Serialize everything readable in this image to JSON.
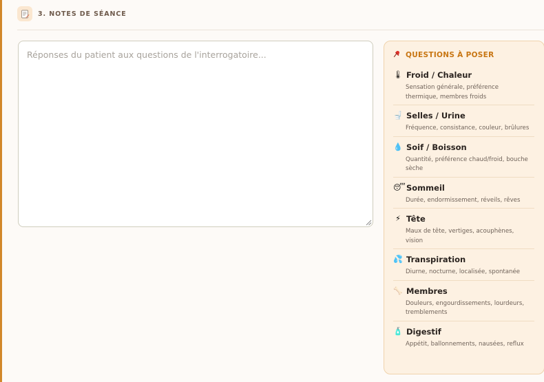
{
  "section": {
    "title": "3. NOTES DE SÉANCE",
    "icon": "memo-icon"
  },
  "notes": {
    "placeholder": "Réponses du patient aux questions de l'interrogatoire...",
    "value": ""
  },
  "questions": {
    "title": "QUESTIONS À POSER",
    "icon": "pushpin-icon",
    "items": [
      {
        "icon": "thermometer-icon",
        "glyph": "🌡",
        "label": "Froid / Chaleur",
        "desc": "Sensation générale, préférence thermique, membres froids"
      },
      {
        "icon": "toilet-icon",
        "glyph": "🚽",
        "label": "Selles / Urine",
        "desc": "Fréquence, consistance, couleur, brûlures"
      },
      {
        "icon": "droplet-icon",
        "glyph": "💧",
        "label": "Soif / Boisson",
        "desc": "Quantité, préférence chaud/froid, bouche sèche"
      },
      {
        "icon": "sleeping-face-icon",
        "glyph": "😴",
        "label": "Sommeil",
        "desc": "Durée, endormissement, réveils, rêves"
      },
      {
        "icon": "head-icon",
        "glyph": "⚡",
        "label": "Tête",
        "desc": "Maux de tête, vertiges, acouphènes, vision"
      },
      {
        "icon": "sweat-droplets-icon",
        "glyph": "💦",
        "label": "Transpiration",
        "desc": "Diurne, nocturne, localisée, spontanée"
      },
      {
        "icon": "bone-icon",
        "glyph": "🦴",
        "label": "Membres",
        "desc": "Douleurs, engourdissements, lourdeurs, tremblements"
      },
      {
        "icon": "bottle-icon",
        "glyph": "🧴",
        "label": "Digestif",
        "desc": "Appétit, ballonnements, nausées, reflux"
      }
    ]
  },
  "colors": {
    "accent": "#d2872a",
    "questions_title": "#c87613",
    "questions_bg": "#fdf1e2",
    "panel_bg": "#fdfaf7"
  }
}
